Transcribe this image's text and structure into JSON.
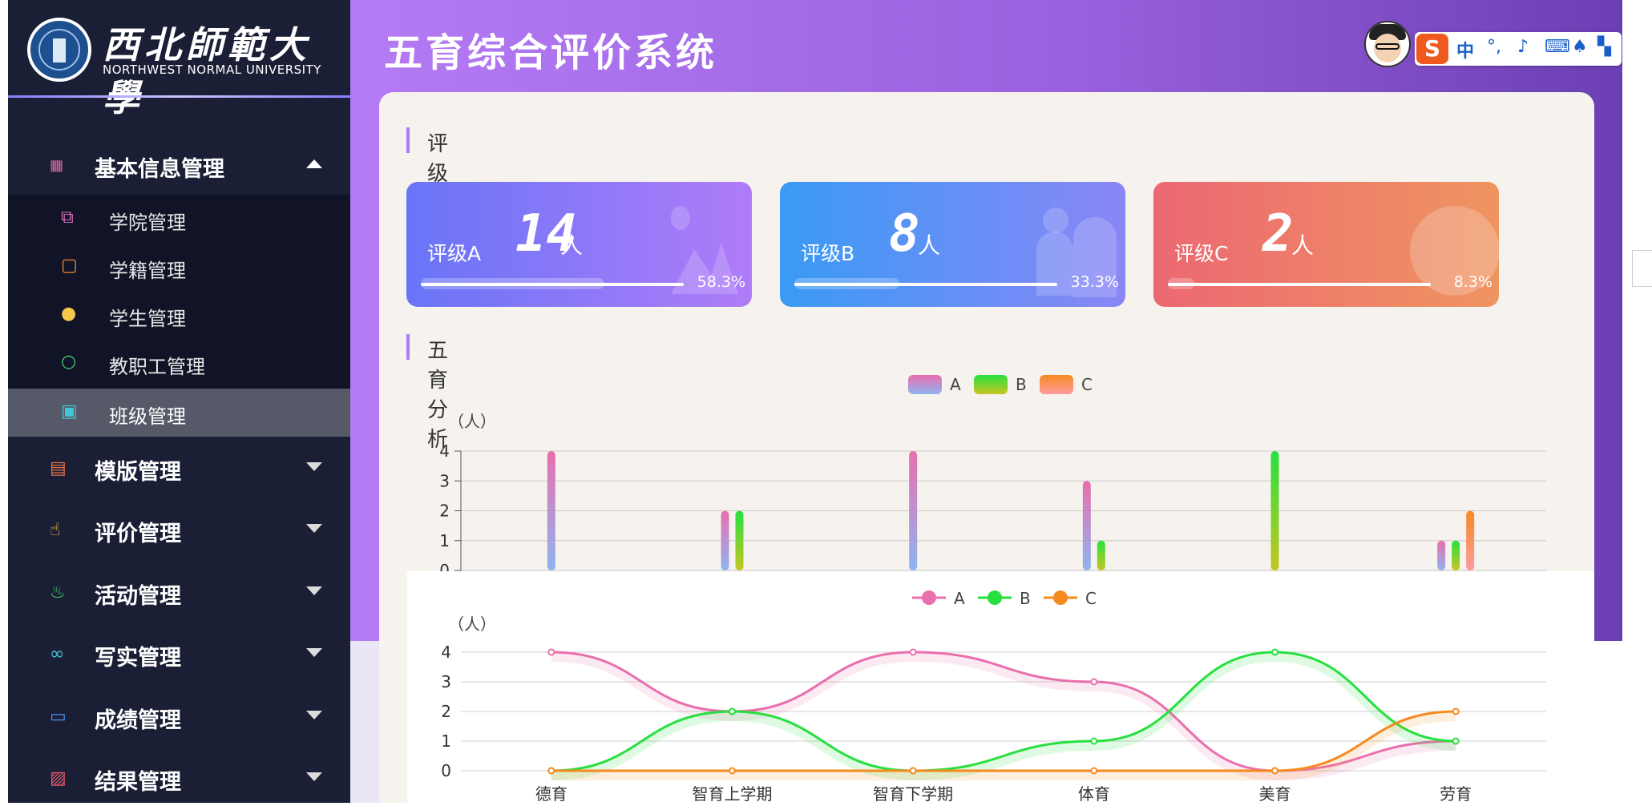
{
  "sidebar": {
    "logo_cn": "西北師範大學",
    "logo_en": "NORTHWEST NORMAL UNIVERSITY",
    "groups": [
      {
        "label": "基本信息管理",
        "icon": "table-icon",
        "expanded": true
      },
      {
        "label": "模版管理",
        "icon": "clipboard-icon",
        "expanded": false
      },
      {
        "label": "评价管理",
        "icon": "thumbs-up-icon",
        "expanded": false
      },
      {
        "label": "活动管理",
        "icon": "flame-icon",
        "expanded": false
      },
      {
        "label": "写实管理",
        "icon": "infinity-icon",
        "expanded": false
      },
      {
        "label": "成绩管理",
        "icon": "presentation-icon",
        "expanded": false
      },
      {
        "label": "结果管理",
        "icon": "image-icon",
        "expanded": false
      }
    ],
    "sub_items": [
      {
        "label": "学院管理",
        "icon": "building-icon",
        "active": false
      },
      {
        "label": "学籍管理",
        "icon": "note-icon",
        "active": false
      },
      {
        "label": "学生管理",
        "icon": "user-icon",
        "active": false
      },
      {
        "label": "教职工管理",
        "icon": "user-outline-icon",
        "active": false
      },
      {
        "label": "班级管理",
        "icon": "photo-icon",
        "active": true
      }
    ]
  },
  "header": {
    "title": "五育综合评价系统",
    "ime": {
      "logo": "S",
      "mode": "中"
    }
  },
  "summary": {
    "section_title": "评级总数分析",
    "cards": [
      {
        "label": "评级A",
        "count": "14",
        "unit": "人",
        "percent": "58.3%",
        "fraction": 0.583
      },
      {
        "label": "评级B",
        "count": "8",
        "unit": "人",
        "percent": "33.3%",
        "fraction": 0.333
      },
      {
        "label": "评级C",
        "count": "2",
        "unit": "人",
        "percent": "8.3%",
        "fraction": 0.083
      }
    ]
  },
  "analysis": {
    "section_title": "五育分析"
  },
  "colors": {
    "A": "#e96fae",
    "A_bar_bottom": "#8fb4f0",
    "B": "#27e03f",
    "B_bar_bottom": "#c6c622",
    "C": "#f58a1f",
    "C_bar": "#ff8f86",
    "card_a": [
      "#6875f7",
      "#b07cf8"
    ],
    "card_b": [
      "#3a9af5",
      "#8b86f6"
    ],
    "card_c": [
      "#ec6872",
      "#ef9560"
    ]
  },
  "chart_data": [
    {
      "type": "bar",
      "categories": [
        "德育",
        "智育上学期",
        "智育下学期",
        "体育",
        "美育",
        "劳育"
      ],
      "series": [
        {
          "name": "A",
          "values": [
            4,
            2,
            4,
            3,
            0,
            1
          ]
        },
        {
          "name": "B",
          "values": [
            0,
            2,
            0,
            1,
            4,
            1
          ]
        },
        {
          "name": "C",
          "values": [
            0,
            0,
            0,
            0,
            0,
            2
          ]
        }
      ],
      "ylabel": "（人）",
      "ylim": [
        0,
        4
      ],
      "yticks": [
        "0",
        "1",
        "2",
        "3",
        "4"
      ],
      "legend": "top-center",
      "grid": true
    },
    {
      "type": "line",
      "categories": [
        "德育",
        "智育上学期",
        "智育下学期",
        "体育",
        "美育",
        "劳育"
      ],
      "series": [
        {
          "name": "A",
          "values": [
            4,
            2,
            4,
            3,
            0,
            1
          ]
        },
        {
          "name": "B",
          "values": [
            0,
            2,
            0,
            1,
            4,
            1
          ]
        },
        {
          "name": "C",
          "values": [
            0,
            0,
            0,
            0,
            0,
            2
          ]
        }
      ],
      "ylabel": "（人）",
      "ylim": [
        0,
        4
      ],
      "yticks": [
        "0",
        "1",
        "2",
        "3",
        "4"
      ],
      "legend": "top-center",
      "grid": true,
      "smooth": true
    }
  ]
}
